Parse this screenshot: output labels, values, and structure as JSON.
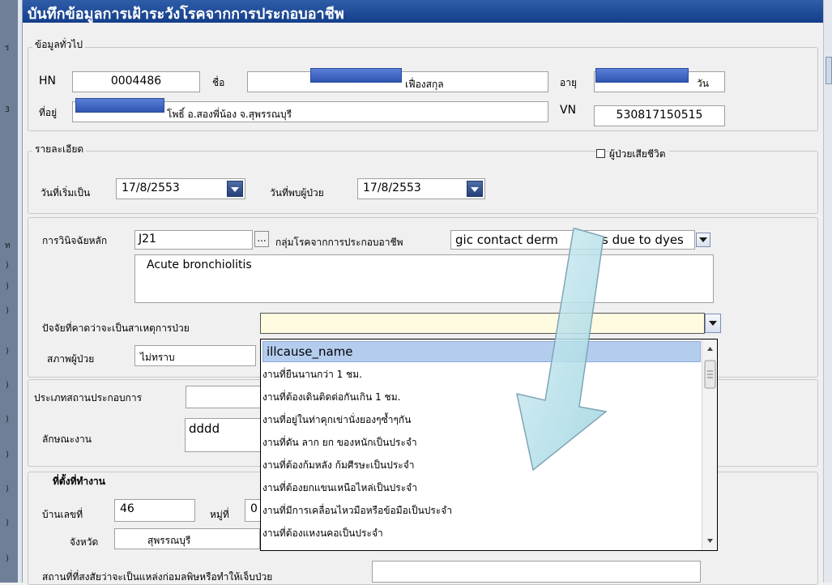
{
  "window": {
    "title": "บันทึกข้อมูลการเฝ้าระวังโรคจากการประกอบอาชีพ"
  },
  "general": {
    "legend": "ข้อมูลทั่วไป",
    "hn_label": "HN",
    "hn_value": "0004486",
    "name_label": "ชื่อ",
    "name_value": "เฟื่องสกุล",
    "age_label": "อายุ",
    "age_unit": "วัน",
    "address_label": "ที่อยู่",
    "address_value": "โพธิ์ อ.สองพี่น้อง จ.สุพรรณบุรี",
    "vn_label": "VN",
    "vn_value": "530817150515"
  },
  "details": {
    "legend": "รายละเอียด",
    "deceased_label": "ผู้ป่วยเสียชีวิต",
    "onset_label": "วันที่เริ่มเป็น",
    "onset_value": "17/8/2553",
    "found_label": "วันที่พบผู้ป่วย",
    "found_value": "17/8/2553"
  },
  "diagnosis": {
    "main_label": "การวินิจฉัยหลัก",
    "main_code": "J21",
    "ellipsis": "...",
    "group_label": "กลุ่มโรคจากการประกอบอาชีพ",
    "group_value": "gic contact derm",
    "group_value_tail": "s due to dyes",
    "description": "Acute bronchiolitis",
    "cause_label": "ปัจจัยที่คาดว่าจะเป็นสาเหตุการป่วย",
    "cause_value": "",
    "status_label": "สภาพผู้ป่วย",
    "status_value": "ไม่ทราบ"
  },
  "cause_dropdown": {
    "header": "illcause_name",
    "options": [
      "งานที่ยืนนานกว่า 1 ชม.",
      "งานที่ต้องเดินติดต่อกันเกิน 1 ชม.",
      "งานที่อยู่ในท่าคุกเข่านั่งยองๆซ้ำๆกัน",
      "งานที่ดัน ลาก ยก ของหนักเป็นประจำ",
      "งานที่ต้องก้มหลัง ก้มศีรษะเป็นประจำ",
      "งานที่ต้องยกแขนเหนือไหล่เป็นประจำ",
      "งานที่มีการเคลื่อนไหวมือหรือข้อมือเป็นประจำ",
      "งานที่ต้องแหงนคอเป็นประจำ"
    ]
  },
  "workplace": {
    "type_label": "ประเภทสถานประกอบการ",
    "type_value": "",
    "job_label": "ลักษณะงาน",
    "job_value": "dddd"
  },
  "location": {
    "legend": "ที่ตั้งที่ทำงาน",
    "house_label": "บ้านเลขที่",
    "house_value": "46",
    "moo_label": "หมู่ที่",
    "moo_value": "0",
    "province_label": "จังหวัด",
    "province_value": "สุพรรณบุรี",
    "suspect_label": "สถานที่ที่สงสัยว่าจะเป็นแหล่งก่อมลพิษหรือทำให้เจ็บป่วย"
  },
  "left_strip_marks": [
    "ร",
    "3",
    "ท",
    ")",
    ")",
    ")",
    ")",
    ")",
    ")",
    ")",
    ")",
    ")",
    ")"
  ],
  "colors": {
    "title_bar": "#1f4a95",
    "dropdown_header": "#b4cdef",
    "arrow_fill": "#a9dbe6",
    "redaction": "#3f64c4"
  }
}
